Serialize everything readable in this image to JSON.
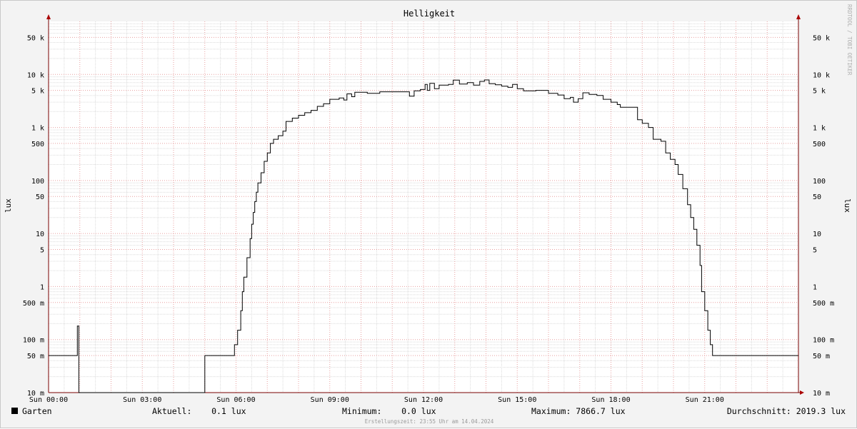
{
  "chart_data": {
    "type": "line",
    "title": "Helligkeit",
    "ylabel": "lux",
    "yscale": "log",
    "ylim": [
      0.01,
      100000
    ],
    "xlim": [
      0,
      24
    ],
    "x_ticks": [
      {
        "x": 0,
        "label": "Sun 00:00"
      },
      {
        "x": 3,
        "label": "Sun 03:00"
      },
      {
        "x": 6,
        "label": "Sun 06:00"
      },
      {
        "x": 9,
        "label": "Sun 09:00"
      },
      {
        "x": 12,
        "label": "Sun 12:00"
      },
      {
        "x": 15,
        "label": "Sun 15:00"
      },
      {
        "x": 18,
        "label": "Sun 18:00"
      },
      {
        "x": 21,
        "label": "Sun 21:00"
      }
    ],
    "y_ticks": [
      {
        "value": 0.01,
        "label": "10 m"
      },
      {
        "value": 0.05,
        "label": "50 m"
      },
      {
        "value": 0.1,
        "label": "100 m"
      },
      {
        "value": 0.5,
        "label": "500 m"
      },
      {
        "value": 1,
        "label": "1"
      },
      {
        "value": 5,
        "label": "5"
      },
      {
        "value": 10,
        "label": "10"
      },
      {
        "value": 50,
        "label": "50"
      },
      {
        "value": 100,
        "label": "100"
      },
      {
        "value": 500,
        "label": "500"
      },
      {
        "value": 1000,
        "label": "1 k"
      },
      {
        "value": 5000,
        "label": "5 k"
      },
      {
        "value": 10000,
        "label": "10 k"
      },
      {
        "value": 50000,
        "label": "50 k"
      }
    ],
    "grid": true,
    "series": [
      {
        "name": "Garten",
        "color": "#000000",
        "step": true,
        "points": [
          [
            0.0,
            0.05
          ],
          [
            0.9,
            0.05
          ],
          [
            0.92,
            0.18
          ],
          [
            0.97,
            0.01
          ],
          [
            5.0,
            0.01
          ],
          [
            5.0,
            0.05
          ],
          [
            5.8,
            0.05
          ],
          [
            5.95,
            0.08
          ],
          [
            6.05,
            0.15
          ],
          [
            6.15,
            0.35
          ],
          [
            6.2,
            0.8
          ],
          [
            6.25,
            1.5
          ],
          [
            6.35,
            3.5
          ],
          [
            6.45,
            8
          ],
          [
            6.5,
            15
          ],
          [
            6.55,
            25
          ],
          [
            6.6,
            40
          ],
          [
            6.65,
            60
          ],
          [
            6.7,
            90
          ],
          [
            6.8,
            140
          ],
          [
            6.9,
            230
          ],
          [
            7.0,
            330
          ],
          [
            7.1,
            500
          ],
          [
            7.2,
            600
          ],
          [
            7.35,
            700
          ],
          [
            7.5,
            850
          ],
          [
            7.6,
            1300
          ],
          [
            7.8,
            1500
          ],
          [
            8.0,
            1700
          ],
          [
            8.2,
            1900
          ],
          [
            8.4,
            2100
          ],
          [
            8.6,
            2500
          ],
          [
            8.8,
            2800
          ],
          [
            9.0,
            3400
          ],
          [
            9.3,
            3600
          ],
          [
            9.45,
            3300
          ],
          [
            9.55,
            4300
          ],
          [
            9.7,
            3800
          ],
          [
            9.8,
            4600
          ],
          [
            10.2,
            4400
          ],
          [
            10.6,
            4700
          ],
          [
            11.2,
            4700
          ],
          [
            11.55,
            3900
          ],
          [
            11.7,
            4900
          ],
          [
            11.9,
            5200
          ],
          [
            12.05,
            6500
          ],
          [
            12.12,
            5000
          ],
          [
            12.2,
            6800
          ],
          [
            12.35,
            5400
          ],
          [
            12.5,
            6300
          ],
          [
            12.8,
            6500
          ],
          [
            12.95,
            7800
          ],
          [
            13.15,
            6600
          ],
          [
            13.4,
            7000
          ],
          [
            13.6,
            6300
          ],
          [
            13.8,
            7400
          ],
          [
            13.95,
            7866.7
          ],
          [
            14.1,
            6700
          ],
          [
            14.3,
            6400
          ],
          [
            14.5,
            6000
          ],
          [
            14.7,
            5700
          ],
          [
            14.85,
            6500
          ],
          [
            15.0,
            5400
          ],
          [
            15.2,
            4900
          ],
          [
            15.6,
            5000
          ],
          [
            16.0,
            4400
          ],
          [
            16.3,
            4100
          ],
          [
            16.5,
            3500
          ],
          [
            16.7,
            3700
          ],
          [
            16.8,
            3000
          ],
          [
            16.95,
            3500
          ],
          [
            17.1,
            4500
          ],
          [
            17.3,
            4200
          ],
          [
            17.55,
            4000
          ],
          [
            17.75,
            3400
          ],
          [
            18.0,
            3000
          ],
          [
            18.2,
            2700
          ],
          [
            18.3,
            2400
          ],
          [
            18.8,
            2400
          ],
          [
            18.85,
            1400
          ],
          [
            19.0,
            1200
          ],
          [
            19.2,
            1000
          ],
          [
            19.35,
            600
          ],
          [
            19.6,
            550
          ],
          [
            19.75,
            330
          ],
          [
            19.9,
            250
          ],
          [
            20.05,
            200
          ],
          [
            20.15,
            130
          ],
          [
            20.3,
            70
          ],
          [
            20.45,
            35
          ],
          [
            20.55,
            20
          ],
          [
            20.65,
            12
          ],
          [
            20.75,
            6
          ],
          [
            20.85,
            2.5
          ],
          [
            20.9,
            0.8
          ],
          [
            21.0,
            0.35
          ],
          [
            21.1,
            0.15
          ],
          [
            21.18,
            0.08
          ],
          [
            21.25,
            0.05
          ],
          [
            24.0,
            0.05
          ]
        ]
      }
    ],
    "legend": {
      "series": "Garten",
      "aktuell": "Aktuell:    0.1 lux",
      "minimum": "Minimum:    0.0 lux",
      "maximum": "Maximum: 7866.7 lux",
      "durchschnitt": "Durchschnitt: 2019.3 lux"
    },
    "footer": "Erstellungszeit: 23:55 Uhr am 14.04.2024",
    "watermark": "RRDTOOL / TOBI OETIKER",
    "colors": {
      "background": "#f3f3f3",
      "canvas": "#ffffff",
      "grid_minor": "#dddddd",
      "grid_major": "#e8a0a0",
      "axis": "#7a0000",
      "line": "#000000"
    }
  }
}
